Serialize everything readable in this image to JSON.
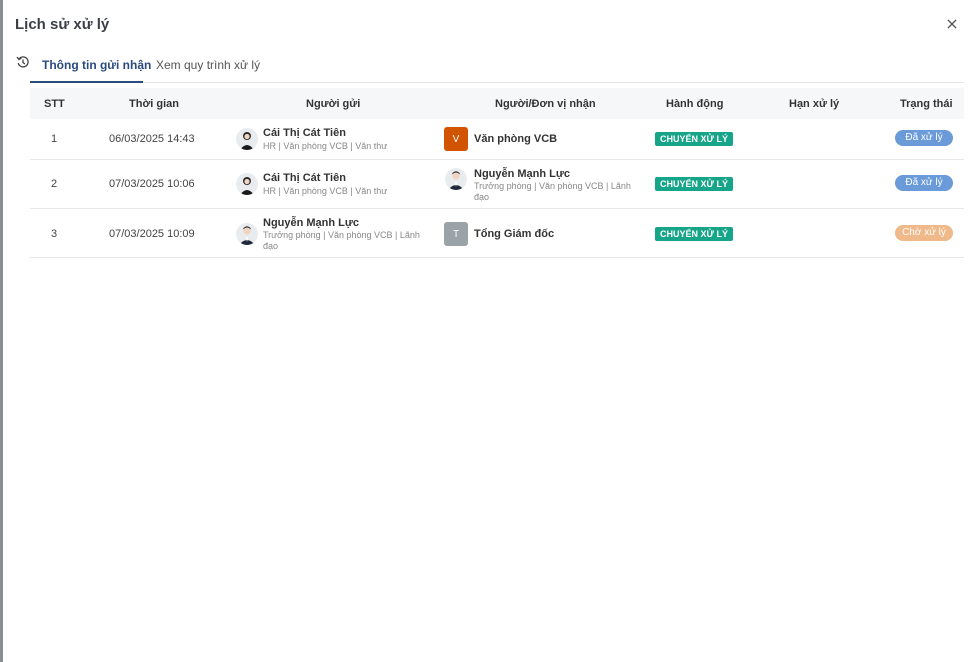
{
  "dialog": {
    "title": "Lịch sử xử lý"
  },
  "tabs": [
    {
      "label": "Thông tin gửi nhận",
      "active": true
    },
    {
      "label": "Xem quy trình xử lý",
      "active": false
    }
  ],
  "table": {
    "headers": [
      "STT",
      "Thời gian",
      "Người gửi",
      "Người/Đơn vị nhận",
      "Hành động",
      "Hạn xử lý",
      "Trạng thái"
    ],
    "rows": [
      {
        "stt": "1",
        "time": "06/03/2025 14:43",
        "sender_name": "Cái Thị Cát Tiên",
        "sender_sub": "HR | Văn phòng VCB | Văn thư",
        "receiver_initial": "V",
        "receiver_name": "Văn phòng VCB",
        "receiver_sub": "",
        "action": "CHUYỂN XỬ LÝ",
        "deadline": "",
        "status": "Đã xử lý"
      },
      {
        "stt": "2",
        "time": "07/03/2025 10:06",
        "sender_name": "Cái Thị Cát Tiên",
        "sender_sub": "HR | Văn phòng VCB | Văn thư",
        "receiver_initial": "",
        "receiver_name": "Nguyễn Mạnh Lực",
        "receiver_sub": "Trưởng phòng | Văn phòng VCB | Lãnh đạo",
        "action": "CHUYỂN XỬ LÝ",
        "deadline": "",
        "status": "Đã xử lý"
      },
      {
        "stt": "3",
        "time": "07/03/2025 10:09",
        "sender_name": "Nguyễn Mạnh Lực",
        "sender_sub": "Trưởng phòng | Văn phòng VCB | Lãnh đạo",
        "receiver_initial": "T",
        "receiver_name": "Tổng Giám đốc",
        "receiver_sub": "",
        "action": "CHUYỂN XỬ LÝ",
        "deadline": "",
        "status": "Chờ xử lý"
      }
    ]
  },
  "colors": {
    "accent": "#2b4a7e",
    "action_badge": "#17a589",
    "status_done": "#6a9bd8",
    "status_waiting": "#f0b98a",
    "square_orange": "#d35400",
    "square_gray": "#9aa3a8"
  },
  "icons": {
    "close": "close-icon",
    "history": "history-icon"
  }
}
